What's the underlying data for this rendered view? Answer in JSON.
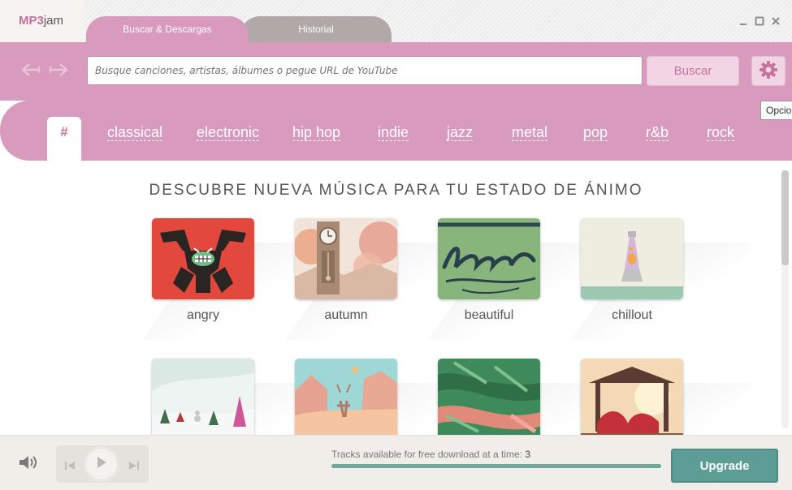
{
  "app": {
    "logo_part1": "MP3",
    "logo_part2": "jam"
  },
  "tabs": [
    {
      "label": "Buscar & Descargas",
      "active": true
    },
    {
      "label": "Historial",
      "active": false
    }
  ],
  "window_controls": {
    "minimize": "—",
    "maximize": "▢",
    "close": "✕"
  },
  "search": {
    "placeholder": "Busque canciones, artistas, álbumes o pegue URL de YouTube",
    "button_label": "Buscar",
    "settings_tooltip": "Opcio"
  },
  "genres": {
    "hash": "#",
    "items": [
      "classical",
      "electronic",
      "hip hop",
      "indie",
      "jazz",
      "metal",
      "pop",
      "r&b",
      "rock"
    ]
  },
  "content": {
    "heading": "DESCUBRE NUEVA MÚSICA PARA TU ESTADO DE ÁNIMO",
    "moods": [
      {
        "label": "angry",
        "icon": "angry-art"
      },
      {
        "label": "autumn",
        "icon": "autumn-art"
      },
      {
        "label": "beautiful",
        "icon": "beautiful-art"
      },
      {
        "label": "chillout",
        "icon": "lava-lamp-art"
      },
      {
        "label": "",
        "icon": "winter-art"
      },
      {
        "label": "",
        "icon": "deer-art"
      },
      {
        "label": "",
        "icon": "leaves-art"
      },
      {
        "label": "",
        "icon": "gazebo-art"
      }
    ]
  },
  "footer": {
    "tracks_text": "Tracks available for free download at a time:",
    "tracks_count": "3",
    "progress_fraction": 1.0,
    "upgrade_label": "Upgrade"
  },
  "colors": {
    "accent_pink": "#d89bbd",
    "upgrade_teal": "#5c9d95",
    "progress_teal": "#6fa79d"
  }
}
